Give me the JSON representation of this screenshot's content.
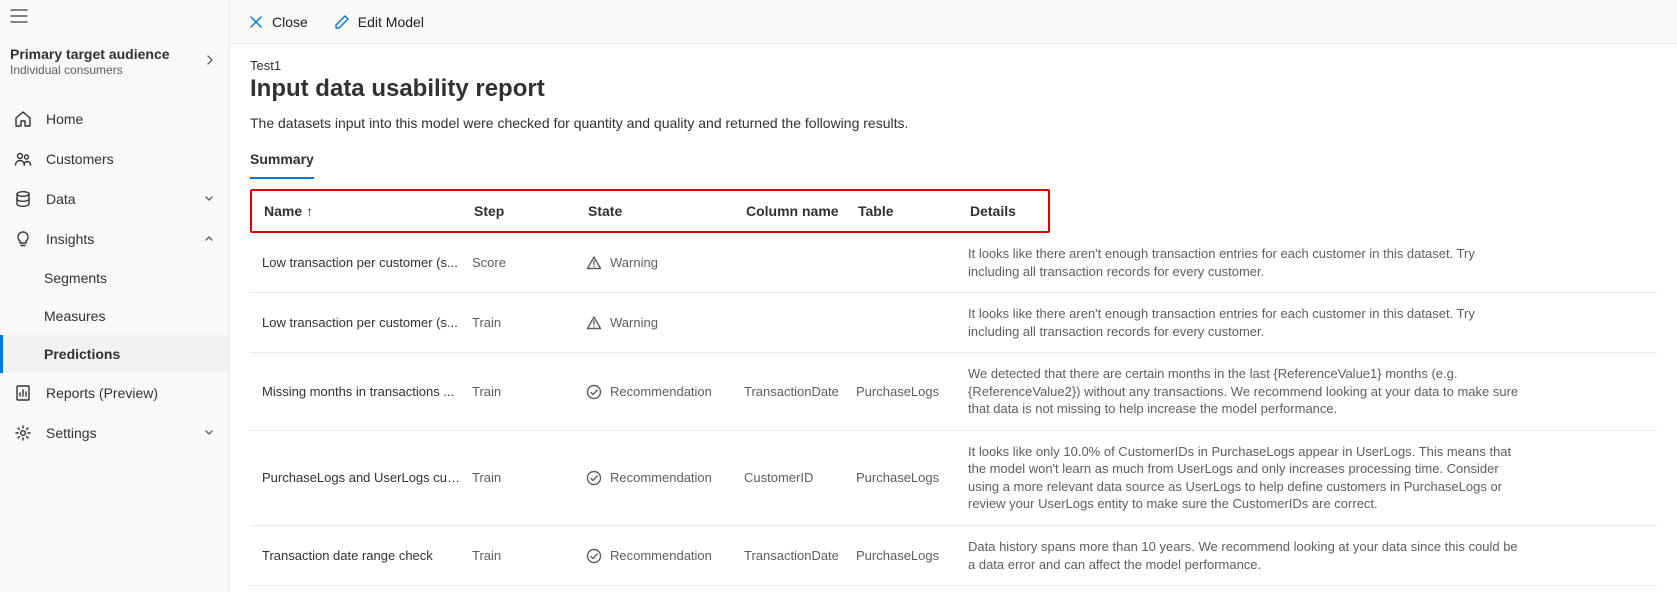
{
  "sidebar": {
    "target_title": "Primary target audience",
    "target_sub": "Individual consumers",
    "items": [
      {
        "key": "home",
        "label": "Home"
      },
      {
        "key": "customers",
        "label": "Customers"
      },
      {
        "key": "data",
        "label": "Data"
      },
      {
        "key": "insights",
        "label": "Insights"
      },
      {
        "key": "segments",
        "label": "Segments"
      },
      {
        "key": "measures",
        "label": "Measures"
      },
      {
        "key": "predictions",
        "label": "Predictions"
      },
      {
        "key": "reports",
        "label": "Reports (Preview)"
      },
      {
        "key": "settings",
        "label": "Settings"
      }
    ]
  },
  "cmdbar": {
    "close": "Close",
    "edit": "Edit Model"
  },
  "page": {
    "breadcrumb": "Test1",
    "title": "Input data usability report",
    "description": "The datasets input into this model were checked for quantity and quality and returned the following results.",
    "tab_summary": "Summary"
  },
  "table": {
    "headers": {
      "name": "Name",
      "step": "Step",
      "state": "State",
      "column": "Column name",
      "table": "Table",
      "details": "Details",
      "sort_dir": "↑"
    },
    "rows": [
      {
        "name": "Low transaction per customer (s...",
        "step": "Score",
        "state_icon": "warning",
        "state": "Warning",
        "column": "",
        "table": "",
        "details": "It looks like there aren't enough transaction entries for each customer in this dataset. Try including all transaction records for every customer."
      },
      {
        "name": "Low transaction per customer (s...",
        "step": "Train",
        "state_icon": "warning",
        "state": "Warning",
        "column": "",
        "table": "",
        "details": "It looks like there aren't enough transaction entries for each customer in this dataset. Try including all transaction records for every customer."
      },
      {
        "name": "Missing months in transactions ...",
        "step": "Train",
        "state_icon": "recommendation",
        "state": "Recommendation",
        "column": "TransactionDate",
        "table": "PurchaseLogs",
        "details": "We detected that there are certain months in the last {ReferenceValue1} months (e.g. {ReferenceValue2}) without any transactions. We recommend looking at your data to make sure that data is not missing to help increase the model performance."
      },
      {
        "name": "PurchaseLogs and UserLogs cus...",
        "step": "Train",
        "state_icon": "recommendation",
        "state": "Recommendation",
        "column": "CustomerID",
        "table": "PurchaseLogs",
        "details": "It looks like only 10.0% of CustomerIDs in PurchaseLogs appear in UserLogs. This means that the model won't learn as much from UserLogs and only increases processing time. Consider using a more relevant data source as UserLogs to help define customers in PurchaseLogs or review your UserLogs entity to make sure the CustomerIDs are correct."
      },
      {
        "name": "Transaction date range check",
        "step": "Train",
        "state_icon": "recommendation",
        "state": "Recommendation",
        "column": "TransactionDate",
        "table": "PurchaseLogs",
        "details": "Data history spans more than 10 years. We recommend looking at your data since this could be a data error and can affect the model performance."
      }
    ]
  }
}
